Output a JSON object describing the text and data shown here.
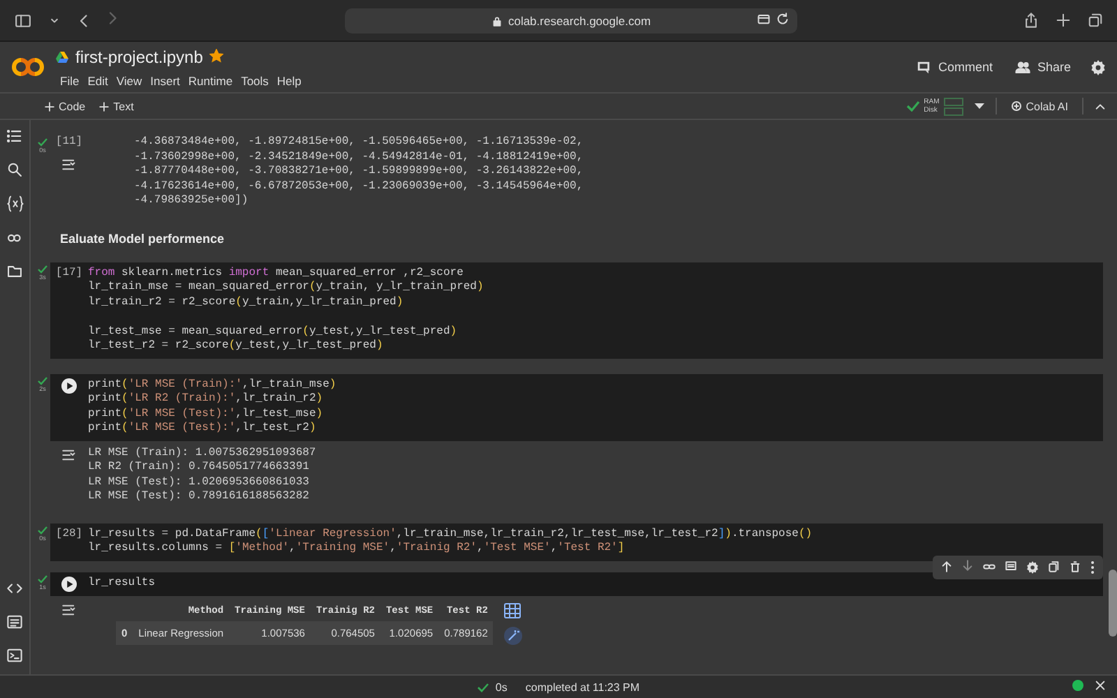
{
  "browser": {
    "url": "colab.research.google.com"
  },
  "notebook": {
    "title": "first-project.ipynb",
    "starred": true
  },
  "menu": [
    "File",
    "Edit",
    "View",
    "Insert",
    "Runtime",
    "Tools",
    "Help"
  ],
  "header_buttons": [
    {
      "label": "Comment",
      "kind": "comment"
    },
    {
      "label": "Share",
      "kind": "share"
    }
  ],
  "toolbar": {
    "add_buttons": [
      "Code",
      "Text"
    ],
    "runtime": {
      "connected": true,
      "labels": [
        "RAM",
        "Disk"
      ]
    },
    "ai_button": "Colab AI"
  },
  "cells": [
    {
      "kind": "code",
      "executed": true,
      "time": "0s",
      "count": "[11]",
      "output": {
        "kind": "text",
        "lines": [
          "-4.36873484e+00, -1.89724815e+00, -1.50596465e+00, -1.16713539e-02,",
          "-1.73602998e+00, -2.34521849e+00, -4.54942814e-01, -4.18812419e+00,",
          "-1.87770448e+00, -3.70838271e+00, -1.59899899e+00, -3.26143822e+00,",
          "-4.17623614e+00, -6.67872053e+00, -1.23069039e+00, -3.14545964e+00,",
          "-4.79863925e+00])"
        ]
      }
    },
    {
      "kind": "markdown",
      "text": "Ealuate Model performence"
    },
    {
      "kind": "code",
      "executed": true,
      "time": "3s",
      "run_button": false,
      "count": "[17]",
      "selected": false,
      "code": [
        [
          [
            {
              "text": "from",
              "kind": "keyword"
            },
            {
              "text": " sklearn.metrics ",
              "kind": "plain"
            },
            {
              "text": "import",
              "kind": "keyword"
            },
            {
              "text": " mean_squared_error ,r2_score",
              "kind": "plain"
            }
          ],
          [
            {
              "text": "lr_train_mse = mean_squared_error",
              "kind": "plain"
            },
            {
              "text": "(",
              "kind": "bracket"
            },
            {
              "text": "y_train, y_lr_train_pred",
              "kind": "plain"
            },
            {
              "text": ")",
              "kind": "bracket"
            }
          ],
          [
            {
              "text": "lr_train_r2 = r2_score",
              "kind": "plain"
            },
            {
              "text": "(",
              "kind": "bracket"
            },
            {
              "text": "y_train,y_lr_train_pred",
              "kind": "plain"
            },
            {
              "text": ")",
              "kind": "bracket"
            }
          ]
        ],
        [
          [
            {
              "text": "lr_test_mse = mean_squared_error",
              "kind": "plain"
            },
            {
              "text": "(",
              "kind": "bracket"
            },
            {
              "text": "y_test,y_lr_test_pred",
              "kind": "plain"
            },
            {
              "text": ")",
              "kind": "bracket"
            }
          ],
          [
            {
              "text": "lr_test_r2 = r2_score",
              "kind": "plain"
            },
            {
              "text": "(",
              "kind": "bracket"
            },
            {
              "text": "y_test,y_lr_test_pred",
              "kind": "plain"
            },
            {
              "text": ")",
              "kind": "bracket"
            }
          ]
        ]
      ]
    },
    {
      "kind": "code",
      "executed": true,
      "time": "2s",
      "run_button": true,
      "selected": false,
      "code": [
        [
          [
            {
              "text": "print",
              "kind": "plain"
            },
            {
              "text": "(",
              "kind": "bracket"
            },
            {
              "text": "'LR MSE (Train):'",
              "kind": "string"
            },
            {
              "text": ",lr_train_mse",
              "kind": "plain"
            },
            {
              "text": ")",
              "kind": "bracket"
            }
          ],
          [
            {
              "text": "print",
              "kind": "plain"
            },
            {
              "text": "(",
              "kind": "bracket"
            },
            {
              "text": "'LR R2 (Train):'",
              "kind": "string"
            },
            {
              "text": ",lr_train_r2",
              "kind": "plain"
            },
            {
              "text": ")",
              "kind": "bracket"
            }
          ],
          [
            {
              "text": "print",
              "kind": "plain"
            },
            {
              "text": "(",
              "kind": "bracket"
            },
            {
              "text": "'LR MSE (Test):'",
              "kind": "string"
            },
            {
              "text": ",lr_test_mse",
              "kind": "plain"
            },
            {
              "text": ")",
              "kind": "bracket"
            }
          ],
          [
            {
              "text": "print",
              "kind": "plain"
            },
            {
              "text": "(",
              "kind": "bracket"
            },
            {
              "text": "'LR MSE (Test):'",
              "kind": "string"
            },
            {
              "text": ",lr_test_r2",
              "kind": "plain"
            },
            {
              "text": ")",
              "kind": "bracket"
            }
          ]
        ]
      ],
      "output": {
        "kind": "text",
        "lines": [
          "LR MSE (Train): 1.0075362951093687",
          "LR R2 (Train): 0.7645051774663391",
          "LR MSE (Test): 1.0206953660861033",
          "LR MSE (Test): 0.7891616188563282"
        ]
      }
    },
    {
      "kind": "code",
      "executed": true,
      "time": "0s",
      "run_button": false,
      "count": "[28]",
      "selected": false,
      "code": [
        [
          [
            {
              "text": "lr_results = pd.DataFrame",
              "kind": "plain"
            },
            {
              "text": "(",
              "kind": "bracket"
            },
            {
              "text": "[",
              "kind": "bracket2"
            },
            {
              "text": "'Linear Regression'",
              "kind": "string"
            },
            {
              "text": ",lr_train_mse,lr_train_r2,lr_test_mse,lr_test_r2",
              "kind": "plain"
            },
            {
              "text": "]",
              "kind": "bracket2"
            },
            {
              "text": ")",
              "kind": "bracket"
            },
            {
              "text": ".transpose",
              "kind": "plain"
            },
            {
              "text": "()",
              "kind": "bracket"
            }
          ],
          [
            {
              "text": "lr_results.columns = ",
              "kind": "plain"
            },
            {
              "text": "[",
              "kind": "bracket"
            },
            {
              "text": "'Method'",
              "kind": "string"
            },
            {
              "text": ",",
              "kind": "plain"
            },
            {
              "text": "'Training MSE'",
              "kind": "string"
            },
            {
              "text": ",",
              "kind": "plain"
            },
            {
              "text": "'Trainig R2'",
              "kind": "string"
            },
            {
              "text": ",",
              "kind": "plain"
            },
            {
              "text": "'Test MSE'",
              "kind": "string"
            },
            {
              "text": ",",
              "kind": "plain"
            },
            {
              "text": "'Test R2'",
              "kind": "string"
            },
            {
              "text": "]",
              "kind": "bracket"
            }
          ]
        ]
      ]
    },
    {
      "kind": "code",
      "executed": true,
      "time": "1s",
      "run_button": true,
      "selected": true,
      "code": [
        [
          [
            {
              "text": "lr_results",
              "kind": "plain"
            }
          ]
        ]
      ],
      "output": {
        "kind": "table",
        "columns": [
          "Method",
          "Training MSE",
          "Trainig R2",
          "Test MSE",
          "Test R2"
        ],
        "rows": [
          {
            "index": "0",
            "cells": [
              "Linear Regression",
              "1.007536",
              "0.764505",
              "1.020695",
              "0.789162"
            ]
          }
        ]
      }
    }
  ],
  "status_bar": {
    "time": "0s",
    "message": "completed at 11:23 PM",
    "connected": true
  }
}
